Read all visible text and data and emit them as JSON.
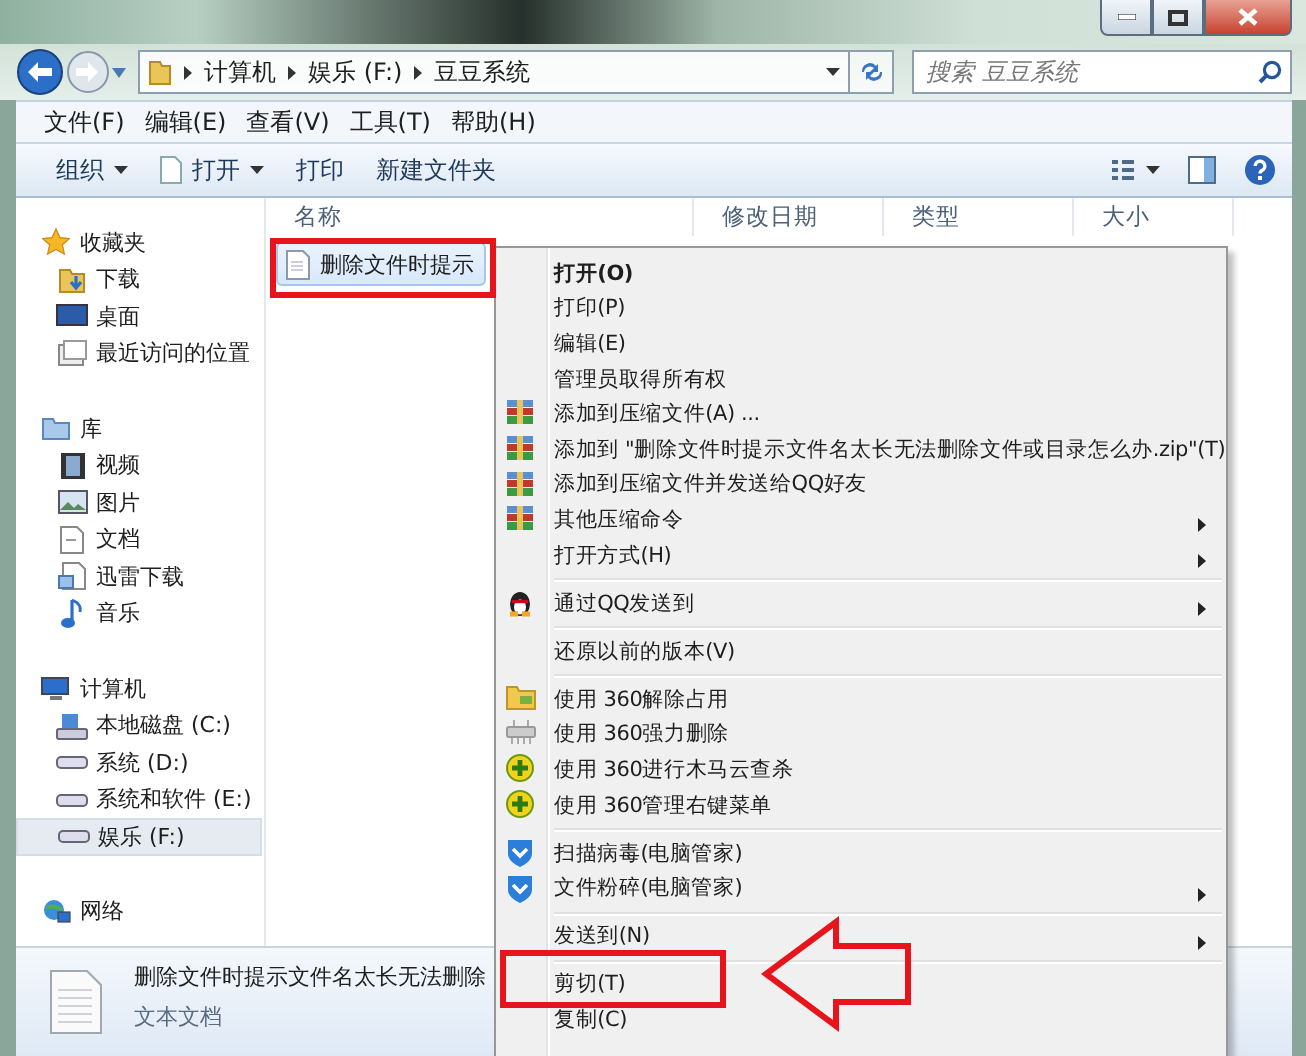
{
  "address_bar": {
    "crumbs": [
      "计算机",
      "娱乐 (F:)",
      "豆豆系统"
    ]
  },
  "search": {
    "placeholder": "搜索 豆豆系统"
  },
  "menu_bar": [
    "文件(F)",
    "编辑(E)",
    "查看(V)",
    "工具(T)",
    "帮助(H)"
  ],
  "toolbar": [
    {
      "label": "组织",
      "dropdown": true,
      "kind": "plain"
    },
    {
      "label": "打开",
      "dropdown": true,
      "kind": "open"
    },
    {
      "label": "打印",
      "dropdown": false,
      "kind": "plain"
    },
    {
      "label": "新建文件夹",
      "dropdown": false,
      "kind": "plain"
    }
  ],
  "columns": [
    "名称",
    "修改日期",
    "类型",
    "大小"
  ],
  "nav": [
    {
      "label": "收藏夹",
      "selected": false,
      "children": [
        {
          "label": "下载",
          "selected": false
        },
        {
          "label": "桌面",
          "selected": false
        },
        {
          "label": "最近访问的位置",
          "selected": false
        }
      ]
    },
    {
      "label": "库",
      "selected": false,
      "children": [
        {
          "label": "视频",
          "selected": false
        },
        {
          "label": "图片",
          "selected": false
        },
        {
          "label": "文档",
          "selected": false
        },
        {
          "label": "迅雷下载",
          "selected": false
        },
        {
          "label": "音乐",
          "selected": false
        }
      ]
    },
    {
      "label": "计算机",
      "selected": false,
      "children": [
        {
          "label": "本地磁盘 (C:)",
          "selected": false
        },
        {
          "label": "系统 (D:)",
          "selected": false
        },
        {
          "label": "系统和软件 (E:)",
          "selected": false
        },
        {
          "label": "娱乐 (F:)",
          "selected": true
        }
      ]
    },
    {
      "label": "网络",
      "selected": false
    }
  ],
  "files": [
    {
      "name": "删除文件时提示",
      "selected": true
    }
  ],
  "context_menu": [
    {
      "kind": "plain",
      "label": "打开(O)",
      "default": true,
      "submenu": false
    },
    {
      "kind": "plain",
      "label": "打印(P)",
      "default": false,
      "submenu": false
    },
    {
      "kind": "plain",
      "label": "编辑(E)",
      "default": false,
      "submenu": false
    },
    {
      "kind": "plain",
      "label": "管理员取得所有权",
      "default": false,
      "submenu": false
    },
    {
      "kind": "archive",
      "label": "添加到压缩文件(A) ...",
      "default": false,
      "submenu": false
    },
    {
      "kind": "archive",
      "label": "添加到 \"删除文件时提示文件名太长无法删除文件或目录怎么办.zip\"(T)",
      "default": false,
      "submenu": false
    },
    {
      "kind": "archive",
      "label": "添加到压缩文件并发送给QQ好友",
      "default": false,
      "submenu": false
    },
    {
      "kind": "archive",
      "label": "其他压缩命令",
      "default": false,
      "submenu": true
    },
    {
      "kind": "plain",
      "label": "打开方式(H)",
      "default": false,
      "submenu": true
    },
    {
      "kind": "separator"
    },
    {
      "kind": "qq",
      "label": "通过QQ发送到",
      "default": false,
      "submenu": true
    },
    {
      "kind": "separator"
    },
    {
      "kind": "plain",
      "label": "还原以前的版本(V)",
      "default": false,
      "submenu": false
    },
    {
      "kind": "separator"
    },
    {
      "kind": "unlock",
      "label": "使用 360解除占用",
      "default": false,
      "submenu": false
    },
    {
      "kind": "shred",
      "label": "使用 360强力删除",
      "default": false,
      "submenu": false
    },
    {
      "kind": "scan360",
      "label": "使用 360进行木马云查杀",
      "default": false,
      "submenu": false
    },
    {
      "kind": "scan360",
      "label": "使用 360管理右键菜单",
      "default": false,
      "submenu": false
    },
    {
      "kind": "separator"
    },
    {
      "kind": "shield",
      "label": "扫描病毒(电脑管家)",
      "default": false,
      "submenu": false
    },
    {
      "kind": "shield",
      "label": "文件粉碎(电脑管家)",
      "default": false,
      "submenu": true
    },
    {
      "kind": "separator"
    },
    {
      "kind": "plain",
      "label": "发送到(N)",
      "default": false,
      "submenu": true
    },
    {
      "kind": "separator"
    },
    {
      "kind": "plain",
      "label": "剪切(T)",
      "default": false,
      "submenu": false
    },
    {
      "kind": "plain",
      "label": "复制(C)",
      "default": false,
      "submenu": false
    }
  ],
  "details_pane": {
    "name": "删除文件时提示文件名太长无法删除",
    "type": "文本文档"
  }
}
